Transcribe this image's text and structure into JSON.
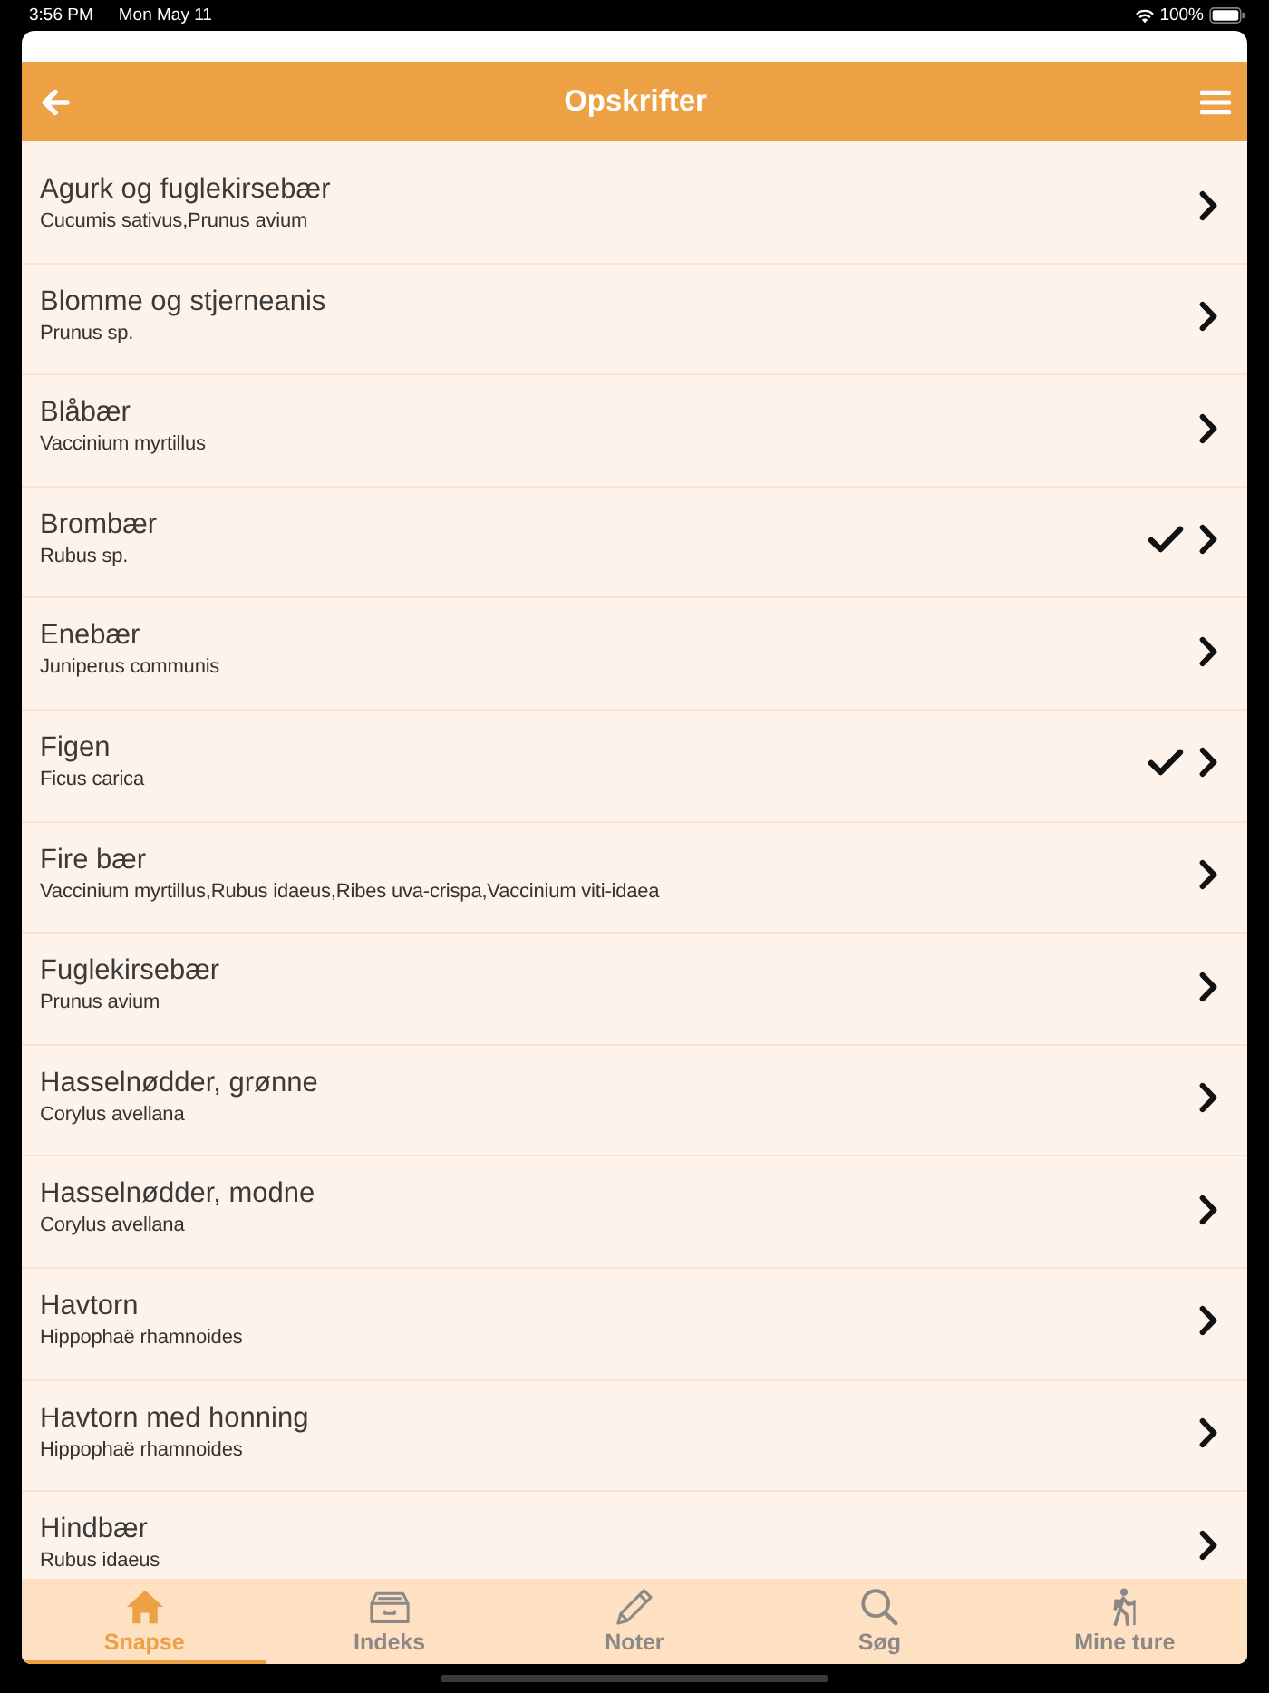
{
  "status_bar": {
    "time": "3:56 PM",
    "date": "Mon May 11",
    "battery": "100%"
  },
  "header": {
    "title": "Opskrifter"
  },
  "recipes": [
    {
      "name": "Agurk og fuglekirsebær",
      "latin": "Cucumis sativus,Prunus avium",
      "checked": false
    },
    {
      "name": "Blomme og stjerneanis",
      "latin": "Prunus sp.",
      "checked": false
    },
    {
      "name": "Blåbær",
      "latin": "Vaccinium myrtillus",
      "checked": false
    },
    {
      "name": "Brombær",
      "latin": "Rubus sp.",
      "checked": true
    },
    {
      "name": "Enebær",
      "latin": "Juniperus communis",
      "checked": false
    },
    {
      "name": "Figen",
      "latin": "Ficus carica",
      "checked": true
    },
    {
      "name": "Fire bær",
      "latin": "Vaccinium myrtillus,Rubus idaeus,Ribes uva-crispa,Vaccinium viti-idaea",
      "checked": false
    },
    {
      "name": "Fuglekirsebær",
      "latin": "Prunus avium",
      "checked": false
    },
    {
      "name": "Hasselnødder, grønne",
      "latin": "Corylus avellana",
      "checked": false
    },
    {
      "name": "Hasselnødder, modne",
      "latin": "Corylus avellana",
      "checked": false
    },
    {
      "name": "Havtorn",
      "latin": "Hippophaë rhamnoides",
      "checked": false
    },
    {
      "name": "Havtorn med honning",
      "latin": "Hippophaë rhamnoides",
      "checked": false
    },
    {
      "name": "Hindbær",
      "latin": "Rubus idaeus",
      "checked": false
    }
  ],
  "tabs": [
    {
      "label": "Snapse",
      "selected": true
    },
    {
      "label": "Indeks",
      "selected": false
    },
    {
      "label": "Noter",
      "selected": false
    },
    {
      "label": "Søg",
      "selected": false
    },
    {
      "label": "Mine ture",
      "selected": false
    }
  ]
}
